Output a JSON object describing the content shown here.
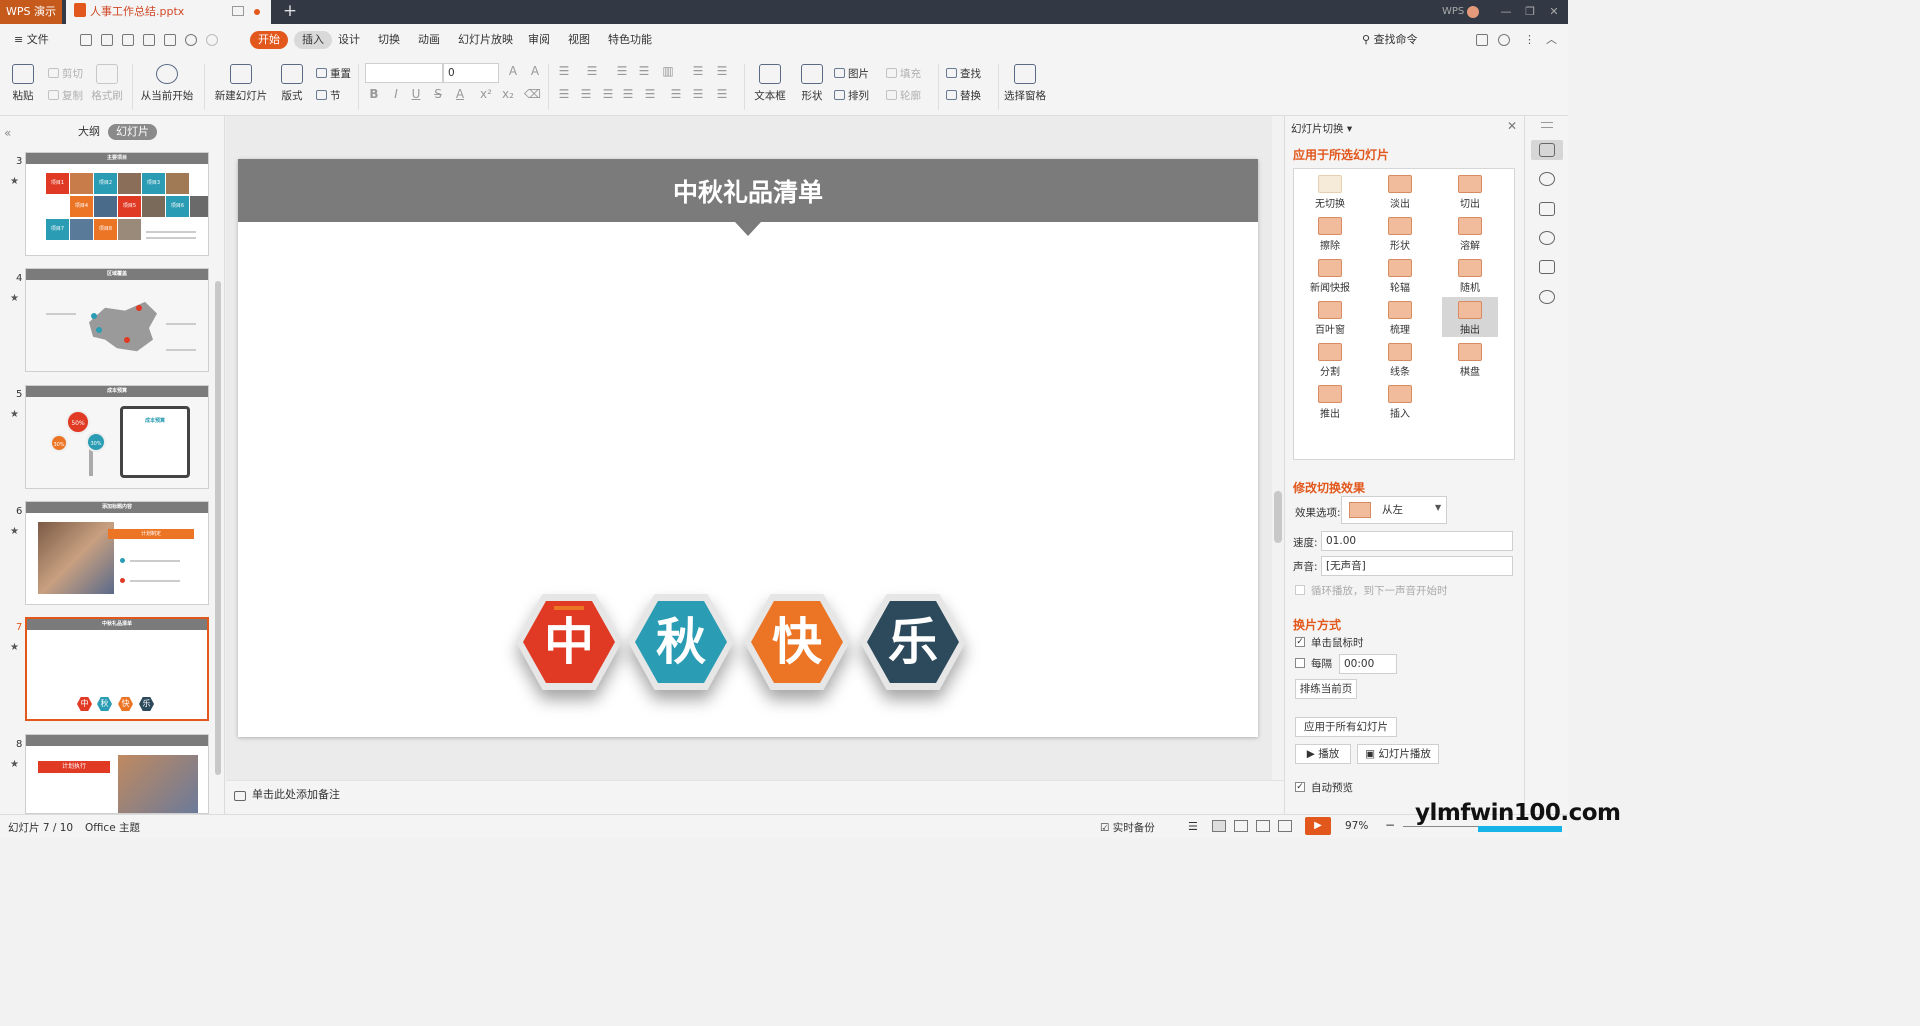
{
  "titlebar": {
    "app_name": "WPS 演示",
    "doc_name": "人事工作总结.pptx",
    "new_tab": "+",
    "brand": "WPS",
    "min": "—",
    "restore": "❐",
    "close": "✕"
  },
  "menubar": {
    "file": "≡ 文件",
    "items": [
      "开始",
      "插入",
      "设计",
      "切换",
      "动画",
      "幻灯片放映",
      "审阅",
      "视图",
      "特色功能"
    ],
    "search": "查找命令"
  },
  "ribbon": {
    "paste": "粘贴",
    "cut": "剪切",
    "copy": "复制",
    "format_painter": "格式刷",
    "from_current": "从当前开始",
    "new_slide": "新建幻灯片",
    "layout": "版式",
    "reset": "重置",
    "section": "节",
    "font_size": "0",
    "textbox": "文本框",
    "shape": "形状",
    "picture": "图片",
    "arrange": "排列",
    "fill": "填充",
    "outline": "轮廓",
    "find": "查找",
    "replace": "替换",
    "selection_pane": "选择窗格"
  },
  "left_panel": {
    "tab_outline": "大纲",
    "tab_slides": "幻灯片",
    "thumbs": [
      {
        "num": "3",
        "title": "主要项目"
      },
      {
        "num": "4",
        "title": "区域覆盖"
      },
      {
        "num": "5",
        "title": "成本预算"
      },
      {
        "num": "6",
        "title": "添加标题内容"
      },
      {
        "num": "7",
        "title": "中秋礼品清单"
      },
      {
        "num": "8",
        "title": ""
      }
    ],
    "t3_tiles": [
      "项目1",
      "项目2",
      "项目3",
      "项目4",
      "项目5",
      "项目6",
      "项目7",
      "项目8"
    ],
    "t5_values": [
      "50%",
      "30%",
      "30%"
    ],
    "t5_card": "成本预算",
    "t6_label": "计划制定",
    "t7_chars": [
      "中",
      "秋",
      "快",
      "乐"
    ],
    "t8_label": "计划执行"
  },
  "slide": {
    "title": "中秋礼品清单",
    "chars": [
      "中",
      "秋",
      "快",
      "乐"
    ]
  },
  "colors": {
    "accent": "#e2571c",
    "hex_red": "#e03a25",
    "hex_teal": "#2a9cb3",
    "hex_orange": "#ec7425",
    "hex_navy": "#2c4a5c"
  },
  "notes": {
    "placeholder": "单击此处添加备注"
  },
  "task_pane": {
    "title": "幻灯片切换 ▾",
    "apply_selected": "应用于所选幻灯片",
    "transitions": [
      "无切换",
      "淡出",
      "切出",
      "擦除",
      "形状",
      "溶解",
      "新闻快报",
      "轮辐",
      "随机",
      "百叶窗",
      "梳理",
      "抽出",
      "分割",
      "线条",
      "棋盘",
      "推出",
      "插入"
    ],
    "selected_transition": "抽出",
    "modify_title": "修改切换效果",
    "effect_label": "效果选项:",
    "effect_value": "从左",
    "speed_label": "速度:",
    "speed_value": "01.00",
    "sound_label": "声音:",
    "sound_value": "[无声音]",
    "loop_label": "循环播放，到下一声音开始时",
    "advance_title": "换片方式",
    "on_click": "单击鼠标时",
    "every": "每隔",
    "every_value": "00:00",
    "rehearse": "排练当前页",
    "apply_all": "应用于所有幻灯片",
    "play": "播放",
    "slideshow": "幻灯片播放",
    "autopreview": "自动预览"
  },
  "statusbar": {
    "slide_info": "幻灯片 7 / 10",
    "theme": "Office 主题",
    "backup": "实时备份",
    "zoom": "97%"
  },
  "watermark": {
    "text": "ylmfwin100.com"
  }
}
